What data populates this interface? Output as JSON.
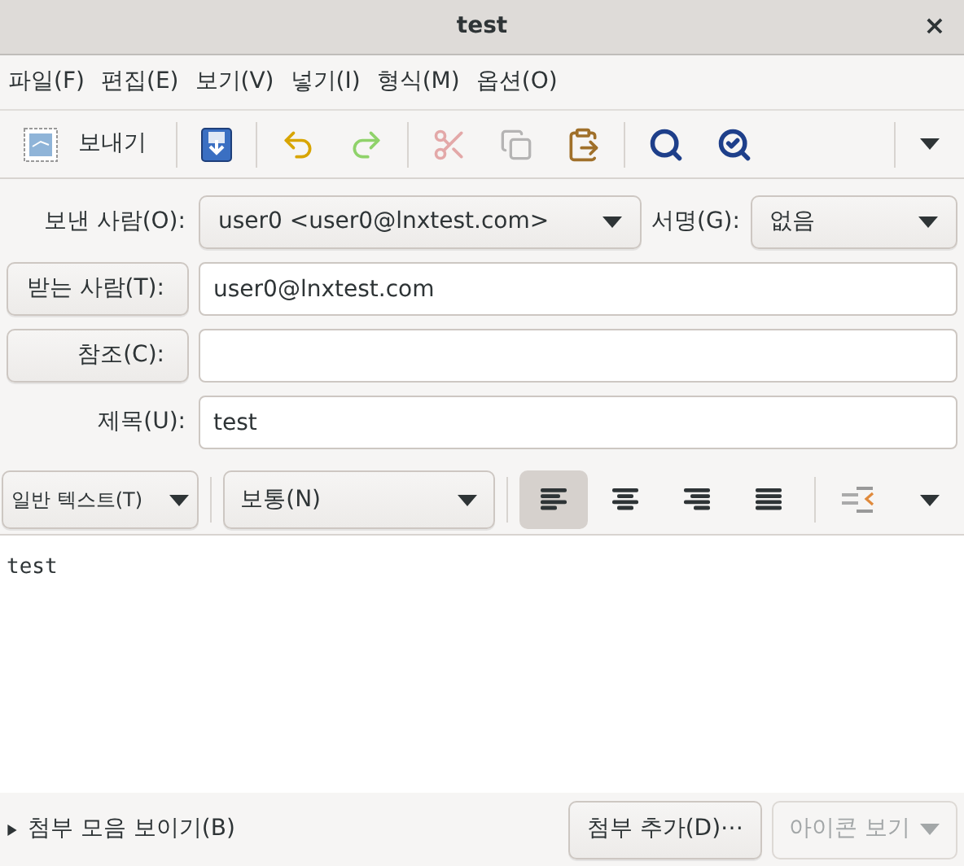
{
  "window": {
    "title": "test",
    "close": "×"
  },
  "menu": [
    "파일(F)",
    "편집(E)",
    "보기(V)",
    "넣기(I)",
    "형식(M)",
    "옵션(O)"
  ],
  "toolbar": [
    {
      "kind": "send",
      "label": "보내기",
      "disabled": false
    },
    {
      "kind": "save",
      "disabled": false
    },
    {
      "kind": "undo",
      "disabled": false
    },
    {
      "kind": "redo",
      "disabled": false
    },
    {
      "kind": "cut",
      "disabled": true
    },
    {
      "kind": "copy",
      "disabled": true
    },
    {
      "kind": "paste",
      "disabled": false
    },
    {
      "kind": "find",
      "disabled": false
    },
    {
      "kind": "spell",
      "disabled": false
    }
  ],
  "header": {
    "from_label": "보낸 사람(O):",
    "from_value": "user0 <user0@lnxtest.com>",
    "signature_label": "서명(G):",
    "signature_value": "없음",
    "to_button": "받는 사람(T):",
    "to_value": "user0@lnxtest.com",
    "cc_button": "참조(C):",
    "subject_label": "제목(U):",
    "subject_value": "test"
  },
  "format_bar": {
    "mode": "일반 텍스트(T)",
    "paragraph": "보통(N)",
    "alignments": [
      {
        "kind": "left",
        "selected": true
      },
      {
        "kind": "center",
        "selected": false
      },
      {
        "kind": "right",
        "selected": false
      },
      {
        "kind": "justify",
        "selected": false
      }
    ]
  },
  "body": "test",
  "footer": {
    "attachments_toggle": "첨부 모음 보이기(B)",
    "expanded": false,
    "add_attachment": "첨부 추가(D)⋯",
    "icon_view": "아이콘 보기",
    "icon_view_disabled": true
  }
}
